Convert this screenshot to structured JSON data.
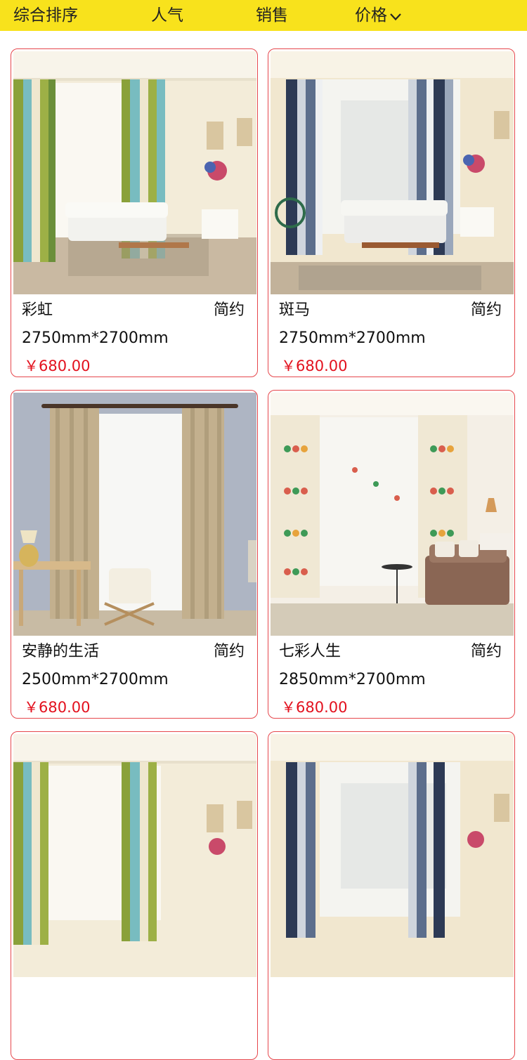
{
  "sort_bar": {
    "tabs": [
      {
        "label": "综合排序"
      },
      {
        "label": "人气"
      },
      {
        "label": "销售"
      },
      {
        "label": "价格"
      }
    ],
    "accent": "#f8e21c",
    "dropdown_icon": "chevron-down-icon"
  },
  "products": [
    {
      "name": "彩虹",
      "style": "简约",
      "size": "2750mm*2700mm",
      "price": "￥680.00"
    },
    {
      "name": "斑马",
      "style": "简约",
      "size": "2750mm*2700mm",
      "price": "￥680.00"
    },
    {
      "name": "安静的生活",
      "style": "简约",
      "size": "2500mm*2700mm",
      "price": "￥680.00"
    },
    {
      "name": "七彩人生",
      "style": "简约",
      "size": "2850mm*2700mm",
      "price": "￥680.00"
    },
    {
      "name": "",
      "style": "",
      "size": "",
      "price": ""
    },
    {
      "name": "",
      "style": "",
      "size": "",
      "price": ""
    }
  ],
  "colors": {
    "price": "#e3111e",
    "card_border": "#e6474c"
  }
}
